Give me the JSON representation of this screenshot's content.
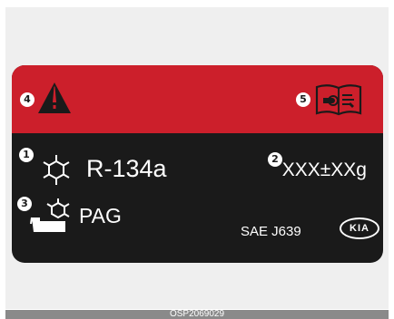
{
  "label": {
    "callouts": [
      "1",
      "2",
      "3",
      "4",
      "5"
    ],
    "refrigerant": "R-134a",
    "amount": "XXX±XXg",
    "oil": "PAG",
    "standard": "SAE J639",
    "brand": "KIA",
    "colors": {
      "band": "#cc1f2b",
      "label": "#1a1a1a",
      "frame": "#efefef",
      "caption_bar": "#8a8a8a"
    },
    "icons": [
      "warning-triangle-icon",
      "service-manual-icon",
      "refrigerant-icon",
      "compressor-oil-icon"
    ]
  },
  "caption": "OSP2069029"
}
